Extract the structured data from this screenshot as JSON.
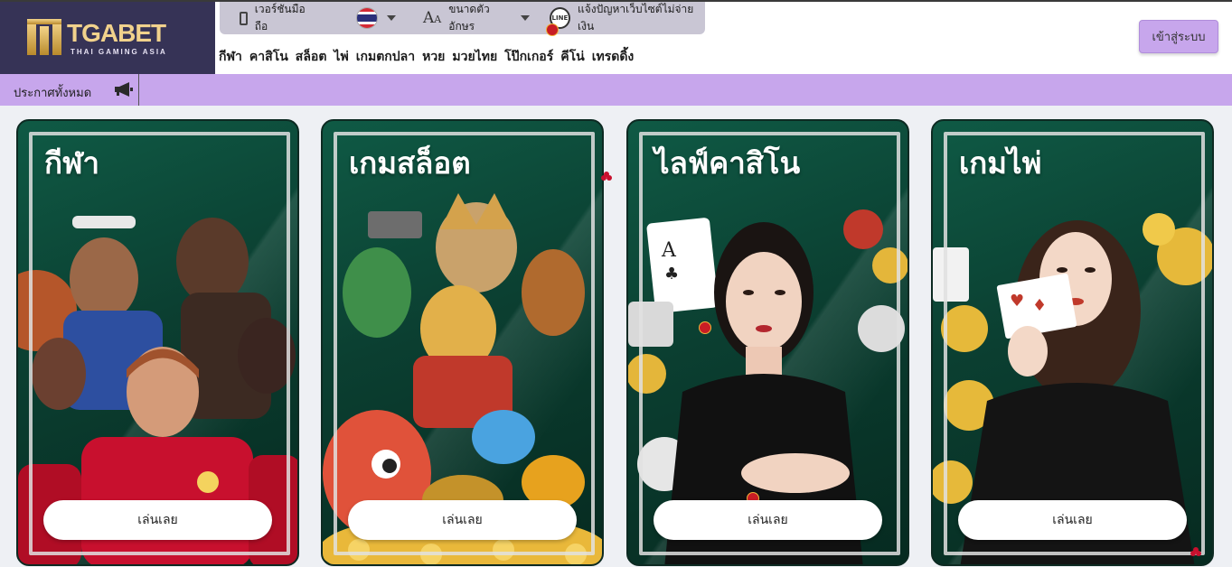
{
  "brand": {
    "name": "TGABET",
    "tagline": "THAI GAMING ASIA"
  },
  "utility_bar": {
    "mobile_label": "เวอร์ชันมือถือ",
    "font_size_label": "ขนาดตัวอักษร",
    "report_label": "แจ้งปัญหาเว็บไซต์ไม่จ่ายเงิน",
    "line_icon_text": "LINE"
  },
  "main_nav": {
    "items": [
      "กีฬา",
      "คาสิโน",
      "สล็อต",
      "ไพ่",
      "เกมตกปลา",
      "หวย",
      "มวยไทย",
      "โป๊กเกอร์",
      "คีโน่",
      "เทรดดิ้ง"
    ]
  },
  "header": {
    "login_label": "เข้าสู่ระบบ"
  },
  "announcement": {
    "label": "ประกาศทั้งหมด"
  },
  "cards": [
    {
      "title": "กีฬา",
      "button_label": "เล่นเลย"
    },
    {
      "title": "เกมสล็อต",
      "button_label": "เล่นเลย"
    },
    {
      "title": "ไลฟ์คาสิโน",
      "button_label": "เล่นเลย"
    },
    {
      "title": "เกมไพ่",
      "button_label": "เล่นเลย"
    }
  ],
  "colors": {
    "logo_bg": "#363356",
    "accent": "#c7a6ec",
    "card_green": "#0f5a45",
    "utility_bg": "#c9c6d4"
  }
}
